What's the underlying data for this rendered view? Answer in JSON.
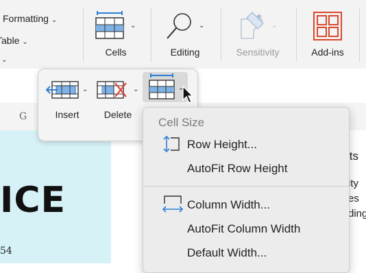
{
  "ribbon": {
    "left_items": [
      {
        "label": "Formatting",
        "has_chevron": true
      },
      {
        "label": "Table",
        "has_chevron": true
      }
    ],
    "groups": {
      "cells": {
        "label": "Cells",
        "icon": "table-cells-icon"
      },
      "editing": {
        "label": "Editing",
        "icon": "magnifier-icon"
      },
      "sensitivity": {
        "label": "Sensitivity",
        "icon": "sensitivity-tag-icon",
        "disabled": true
      },
      "addins": {
        "label": "Add-ins",
        "icon": "add-ins-grid-icon"
      }
    }
  },
  "column_header": {
    "letter": "G"
  },
  "sheet": {
    "big_text": "ICE",
    "small_number": "54",
    "right_texts": [
      "lts",
      "ity",
      "es",
      "ding"
    ]
  },
  "cells_popup": {
    "buttons": [
      {
        "label": "Insert",
        "icon": "insert-cells-icon"
      },
      {
        "label": "Delete",
        "icon": "delete-cells-icon"
      },
      {
        "label": "",
        "icon": "format-cells-icon",
        "hovered": true
      }
    ]
  },
  "format_menu": {
    "header": "Cell Size",
    "items": [
      {
        "label": "Row Height...",
        "icon": "row-height-icon"
      },
      {
        "label": "AutoFit Row Height",
        "icon": ""
      },
      {
        "label": "Column Width...",
        "icon": "column-width-icon"
      },
      {
        "label": "AutoFit Column Width",
        "icon": ""
      },
      {
        "label": "Default Width...",
        "icon": ""
      }
    ]
  },
  "colors": {
    "accent_blue": "#2d7fd3",
    "addins_red": "#d9472b",
    "cell_cyan": "#d6f2f7"
  }
}
